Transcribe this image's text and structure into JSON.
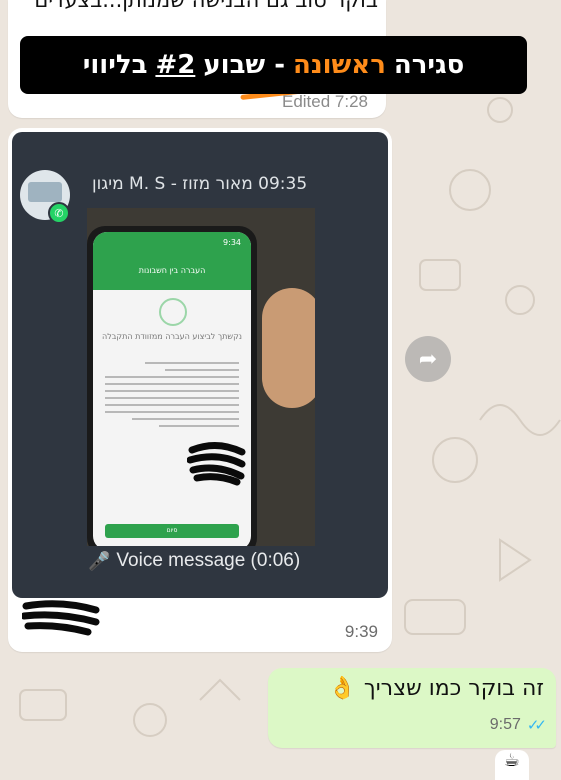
{
  "banner": {
    "part1": "סגירה",
    "part2": "ראשונה",
    "part3": "- שבוע",
    "part4": "#2",
    "part5": "בליווי"
  },
  "top_message": {
    "partial_text": "בוקר טוב גם הבנישה שמנותן...בצעדים",
    "edited_label": "Edited 7:28"
  },
  "forwarded_message": {
    "sender": "09:35 מאור מזוז - M. S מיגון",
    "voice_label": "Voice message (0:06)",
    "time": "9:39",
    "screen_status_time": "9:34",
    "screen_header": "העברה בין חשבונות",
    "screen_title": "נקשתך לביצוע העברה ממזוודת התקבלה",
    "screen_button": "סיום"
  },
  "outgoing_message": {
    "text": "זה בוקר כמו שצריך",
    "emoji": "👌",
    "time": "9:57",
    "status": "read"
  },
  "colors": {
    "wallpaper": "#ece5dd",
    "outgoing_bubble": "#dcf8c6",
    "accent_orange": "#ff8c1a",
    "read_ticks": "#34b7f1",
    "dark_card": "#2f3640",
    "whatsapp_green": "#25d366"
  },
  "icons": [
    "forward-icon",
    "microphone-icon",
    "whatsapp-icon",
    "ok-hand-icon",
    "double-check-icon",
    "coffee-icon"
  ]
}
